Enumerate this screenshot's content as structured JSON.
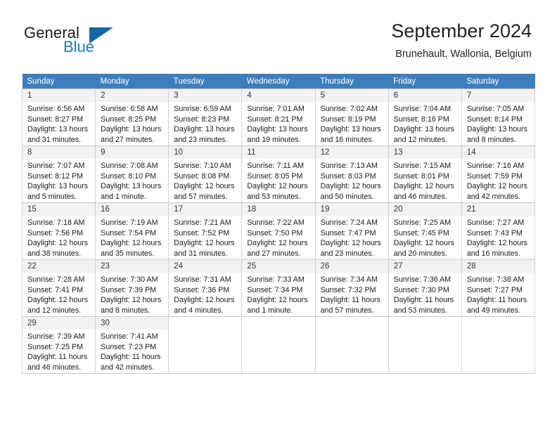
{
  "brand": {
    "name_part1": "General",
    "name_part2": "Blue",
    "flag_icon": "triangle-flag-icon"
  },
  "header": {
    "title": "September 2024",
    "location": "Brunehault, Wallonia, Belgium"
  },
  "theme": {
    "header_bar": "#3d7ebf",
    "brand_blue": "#1f7ac4",
    "flag_blue": "#1565a8",
    "daynum_bg": "#f2f2f2",
    "grid_line": "#c8c8c8"
  },
  "weekday_headers": [
    "Sunday",
    "Monday",
    "Tuesday",
    "Wednesday",
    "Thursday",
    "Friday",
    "Saturday"
  ],
  "weeks": [
    [
      {
        "day": "1",
        "sunrise": "Sunrise: 6:56 AM",
        "sunset": "Sunset: 8:27 PM",
        "daylight1": "Daylight: 13 hours",
        "daylight2": "and 31 minutes."
      },
      {
        "day": "2",
        "sunrise": "Sunrise: 6:58 AM",
        "sunset": "Sunset: 8:25 PM",
        "daylight1": "Daylight: 13 hours",
        "daylight2": "and 27 minutes."
      },
      {
        "day": "3",
        "sunrise": "Sunrise: 6:59 AM",
        "sunset": "Sunset: 8:23 PM",
        "daylight1": "Daylight: 13 hours",
        "daylight2": "and 23 minutes."
      },
      {
        "day": "4",
        "sunrise": "Sunrise: 7:01 AM",
        "sunset": "Sunset: 8:21 PM",
        "daylight1": "Daylight: 13 hours",
        "daylight2": "and 19 minutes."
      },
      {
        "day": "5",
        "sunrise": "Sunrise: 7:02 AM",
        "sunset": "Sunset: 8:19 PM",
        "daylight1": "Daylight: 13 hours",
        "daylight2": "and 16 minutes."
      },
      {
        "day": "6",
        "sunrise": "Sunrise: 7:04 AM",
        "sunset": "Sunset: 8:16 PM",
        "daylight1": "Daylight: 13 hours",
        "daylight2": "and 12 minutes."
      },
      {
        "day": "7",
        "sunrise": "Sunrise: 7:05 AM",
        "sunset": "Sunset: 8:14 PM",
        "daylight1": "Daylight: 13 hours",
        "daylight2": "and 8 minutes."
      }
    ],
    [
      {
        "day": "8",
        "sunrise": "Sunrise: 7:07 AM",
        "sunset": "Sunset: 8:12 PM",
        "daylight1": "Daylight: 13 hours",
        "daylight2": "and 5 minutes."
      },
      {
        "day": "9",
        "sunrise": "Sunrise: 7:08 AM",
        "sunset": "Sunset: 8:10 PM",
        "daylight1": "Daylight: 13 hours",
        "daylight2": "and 1 minute."
      },
      {
        "day": "10",
        "sunrise": "Sunrise: 7:10 AM",
        "sunset": "Sunset: 8:08 PM",
        "daylight1": "Daylight: 12 hours",
        "daylight2": "and 57 minutes."
      },
      {
        "day": "11",
        "sunrise": "Sunrise: 7:11 AM",
        "sunset": "Sunset: 8:05 PM",
        "daylight1": "Daylight: 12 hours",
        "daylight2": "and 53 minutes."
      },
      {
        "day": "12",
        "sunrise": "Sunrise: 7:13 AM",
        "sunset": "Sunset: 8:03 PM",
        "daylight1": "Daylight: 12 hours",
        "daylight2": "and 50 minutes."
      },
      {
        "day": "13",
        "sunrise": "Sunrise: 7:15 AM",
        "sunset": "Sunset: 8:01 PM",
        "daylight1": "Daylight: 12 hours",
        "daylight2": "and 46 minutes."
      },
      {
        "day": "14",
        "sunrise": "Sunrise: 7:16 AM",
        "sunset": "Sunset: 7:59 PM",
        "daylight1": "Daylight: 12 hours",
        "daylight2": "and 42 minutes."
      }
    ],
    [
      {
        "day": "15",
        "sunrise": "Sunrise: 7:18 AM",
        "sunset": "Sunset: 7:56 PM",
        "daylight1": "Daylight: 12 hours",
        "daylight2": "and 38 minutes."
      },
      {
        "day": "16",
        "sunrise": "Sunrise: 7:19 AM",
        "sunset": "Sunset: 7:54 PM",
        "daylight1": "Daylight: 12 hours",
        "daylight2": "and 35 minutes."
      },
      {
        "day": "17",
        "sunrise": "Sunrise: 7:21 AM",
        "sunset": "Sunset: 7:52 PM",
        "daylight1": "Daylight: 12 hours",
        "daylight2": "and 31 minutes."
      },
      {
        "day": "18",
        "sunrise": "Sunrise: 7:22 AM",
        "sunset": "Sunset: 7:50 PM",
        "daylight1": "Daylight: 12 hours",
        "daylight2": "and 27 minutes."
      },
      {
        "day": "19",
        "sunrise": "Sunrise: 7:24 AM",
        "sunset": "Sunset: 7:47 PM",
        "daylight1": "Daylight: 12 hours",
        "daylight2": "and 23 minutes."
      },
      {
        "day": "20",
        "sunrise": "Sunrise: 7:25 AM",
        "sunset": "Sunset: 7:45 PM",
        "daylight1": "Daylight: 12 hours",
        "daylight2": "and 20 minutes."
      },
      {
        "day": "21",
        "sunrise": "Sunrise: 7:27 AM",
        "sunset": "Sunset: 7:43 PM",
        "daylight1": "Daylight: 12 hours",
        "daylight2": "and 16 minutes."
      }
    ],
    [
      {
        "day": "22",
        "sunrise": "Sunrise: 7:28 AM",
        "sunset": "Sunset: 7:41 PM",
        "daylight1": "Daylight: 12 hours",
        "daylight2": "and 12 minutes."
      },
      {
        "day": "23",
        "sunrise": "Sunrise: 7:30 AM",
        "sunset": "Sunset: 7:39 PM",
        "daylight1": "Daylight: 12 hours",
        "daylight2": "and 8 minutes."
      },
      {
        "day": "24",
        "sunrise": "Sunrise: 7:31 AM",
        "sunset": "Sunset: 7:36 PM",
        "daylight1": "Daylight: 12 hours",
        "daylight2": "and 4 minutes."
      },
      {
        "day": "25",
        "sunrise": "Sunrise: 7:33 AM",
        "sunset": "Sunset: 7:34 PM",
        "daylight1": "Daylight: 12 hours",
        "daylight2": "and 1 minute."
      },
      {
        "day": "26",
        "sunrise": "Sunrise: 7:34 AM",
        "sunset": "Sunset: 7:32 PM",
        "daylight1": "Daylight: 11 hours",
        "daylight2": "and 57 minutes."
      },
      {
        "day": "27",
        "sunrise": "Sunrise: 7:36 AM",
        "sunset": "Sunset: 7:30 PM",
        "daylight1": "Daylight: 11 hours",
        "daylight2": "and 53 minutes."
      },
      {
        "day": "28",
        "sunrise": "Sunrise: 7:38 AM",
        "sunset": "Sunset: 7:27 PM",
        "daylight1": "Daylight: 11 hours",
        "daylight2": "and 49 minutes."
      }
    ],
    [
      {
        "day": "29",
        "sunrise": "Sunrise: 7:39 AM",
        "sunset": "Sunset: 7:25 PM",
        "daylight1": "Daylight: 11 hours",
        "daylight2": "and 46 minutes."
      },
      {
        "day": "30",
        "sunrise": "Sunrise: 7:41 AM",
        "sunset": "Sunset: 7:23 PM",
        "daylight1": "Daylight: 11 hours",
        "daylight2": "and 42 minutes."
      },
      {
        "day": "",
        "sunrise": "",
        "sunset": "",
        "daylight1": "",
        "daylight2": ""
      },
      {
        "day": "",
        "sunrise": "",
        "sunset": "",
        "daylight1": "",
        "daylight2": ""
      },
      {
        "day": "",
        "sunrise": "",
        "sunset": "",
        "daylight1": "",
        "daylight2": ""
      },
      {
        "day": "",
        "sunrise": "",
        "sunset": "",
        "daylight1": "",
        "daylight2": ""
      },
      {
        "day": "",
        "sunrise": "",
        "sunset": "",
        "daylight1": "",
        "daylight2": ""
      }
    ]
  ]
}
